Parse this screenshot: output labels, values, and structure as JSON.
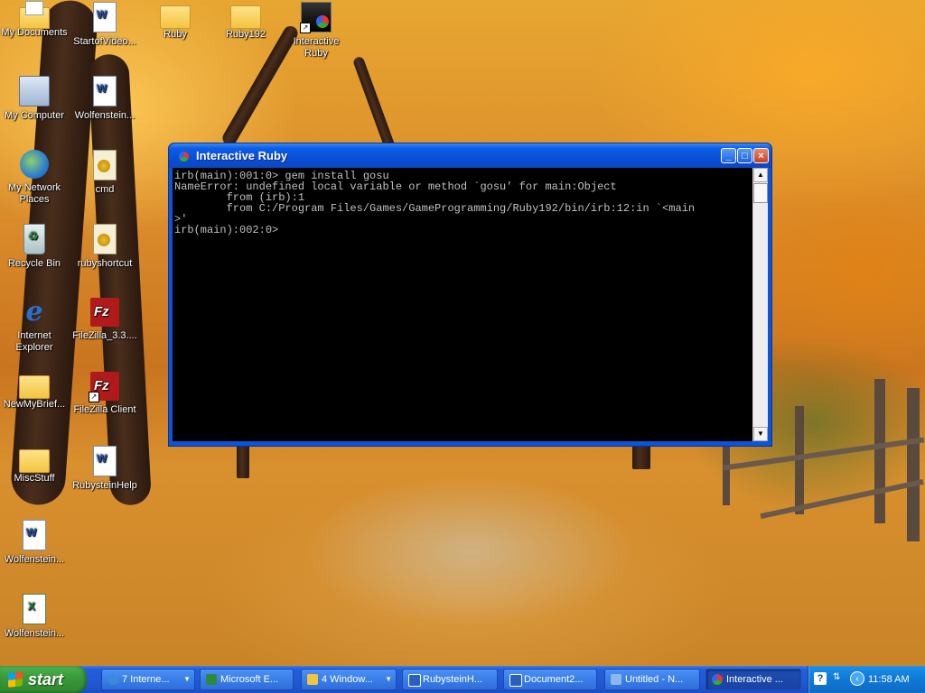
{
  "desktop": {
    "icons": [
      {
        "label": "My Documents",
        "icon": "my-documents-icon"
      },
      {
        "label": "StartofVideo...",
        "icon": "word-document-icon"
      },
      {
        "label": "Ruby",
        "icon": "folder-icon"
      },
      {
        "label": "Ruby192",
        "icon": "folder-icon"
      },
      {
        "label": "Interactive Ruby",
        "icon": "interactive-ruby-shortcut-icon"
      },
      {
        "label": "My Computer",
        "icon": "my-computer-icon"
      },
      {
        "label": "Wolfenstein...",
        "icon": "word-document-icon"
      },
      {
        "label": "My Network Places",
        "icon": "network-places-icon"
      },
      {
        "label": "cmd",
        "icon": "jpg-image-icon"
      },
      {
        "label": "Recycle Bin",
        "icon": "recycle-bin-icon"
      },
      {
        "label": "rubyshortcut",
        "icon": "jpg-image-icon"
      },
      {
        "label": "Internet Explorer",
        "icon": "internet-explorer-icon"
      },
      {
        "label": "FileZilla_3.3....",
        "icon": "filezilla-icon"
      },
      {
        "label": "NewMyBrief...",
        "icon": "folder-icon"
      },
      {
        "label": "FileZilla Client",
        "icon": "filezilla-shortcut-icon"
      },
      {
        "label": "MiscStuff",
        "icon": "folder-icon"
      },
      {
        "label": "RubysteinHelp",
        "icon": "word-document-icon"
      },
      {
        "label": "Wolfenstein...",
        "icon": "text-document-icon"
      },
      {
        "label": "Wolfenstein...",
        "icon": "excel-document-icon"
      }
    ]
  },
  "window": {
    "title": "Interactive Ruby",
    "minimize": "_",
    "maximize": "□",
    "close": "×",
    "console_lines": [
      "irb(main):001:0> gem install gosu",
      "NameError: undefined local variable or method `gosu' for main:Object",
      "        from (irb):1",
      "        from C:/Program Files/Games/GameProgramming/Ruby192/bin/irb:12:in `<main",
      ">'",
      "irb(main):002:0>"
    ],
    "scroll_up": "▲",
    "scroll_down": "▼"
  },
  "taskbar": {
    "start_label": "start",
    "items": [
      {
        "label": "7 Interne...",
        "icon": "internet-explorer-icon",
        "color": "#3a8ad8",
        "grouped": true
      },
      {
        "label": "Microsoft E...",
        "icon": "excel-icon",
        "color": "#2e8a3a",
        "grouped": false
      },
      {
        "label": "4 Window...",
        "icon": "folder-icon",
        "color": "#f3c440",
        "grouped": true
      },
      {
        "label": "RubysteinH...",
        "icon": "word-icon",
        "color": "#2a5fc0",
        "grouped": false
      },
      {
        "label": "Document2...",
        "icon": "word-icon",
        "color": "#2a5fc0",
        "grouped": false
      },
      {
        "label": "Untitled - N...",
        "icon": "notepad-icon",
        "color": "#8ab8e8",
        "grouped": false
      },
      {
        "label": "Interactive ...",
        "icon": "interactive-ruby-icon",
        "color": "#e33",
        "grouped": false,
        "active": true
      }
    ],
    "tray": {
      "help": "?",
      "clock": "11:58 AM"
    }
  }
}
